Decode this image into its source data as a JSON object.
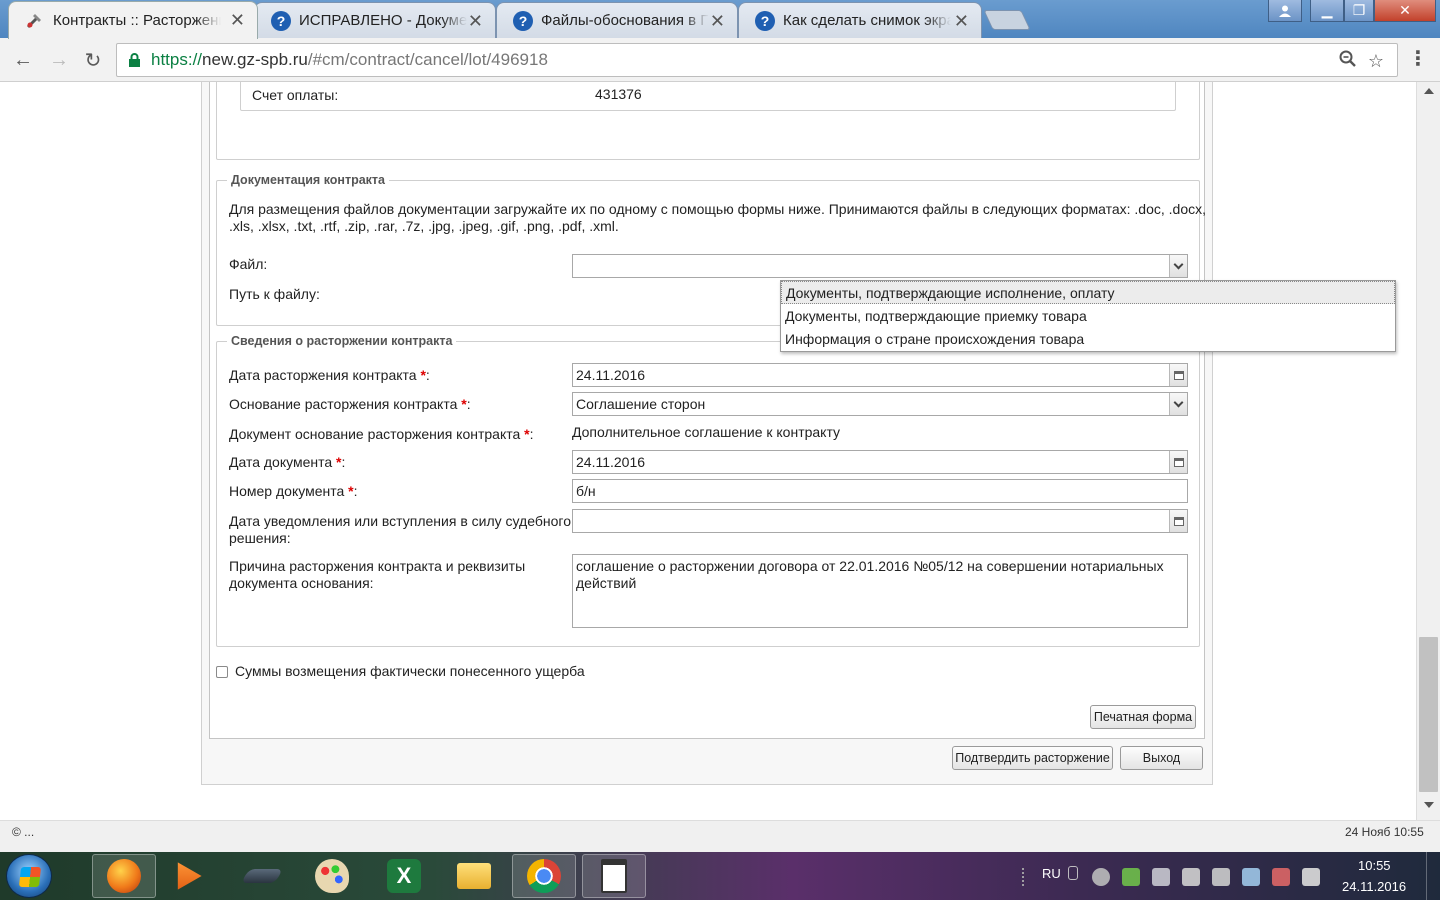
{
  "browser": {
    "tabs": [
      {
        "title": "Контракты :: Расторжение",
        "active": true
      },
      {
        "title": "ИСПРАВЛЕНО - Документы",
        "active": false
      },
      {
        "title": "Файлы-обоснования в ГИС",
        "active": false
      },
      {
        "title": "Как сделать снимок экрана",
        "active": false
      }
    ],
    "url": {
      "scheme": "https://",
      "host": "new.gz-spb.ru",
      "path": "/#cm/contract/cancel/lot/496918"
    }
  },
  "page": {
    "payment": {
      "label": "Счет оплаты:",
      "value": "431376"
    },
    "documentation": {
      "legend": "Документация контракта",
      "instructions_line1": "Для размещения файлов документации загружайте их по одному с помощью формы ниже. Принимаются файлы в следующих форматах: .doc, .docx,",
      "instructions_line2": ".xls, .xlsx, .txt, .rtf, .zip, .rar, .7z, .jpg, .jpeg, .gif, .png, .pdf, .xml.",
      "file_label": "Файл:",
      "file_value": "",
      "path_label": "Путь к файлу:",
      "dropdown_options": [
        "Документы, подтверждающие исполнение, оплату",
        "Документы, подтверждающие приемку товара",
        "Информация о стране происхождения товара"
      ]
    },
    "termination": {
      "legend": "Сведения о расторжении контракта",
      "required_mark": "*",
      "date_label": "Дата расторжения контракта ",
      "date_value": "24.11.2016",
      "basis_label": "Основание расторжения контракта ",
      "basis_value": "Соглашение сторон",
      "doc_basis_label": "Документ основание расторжения контракта ",
      "doc_basis_value": "Дополнительное соглашение к контракту",
      "doc_date_label": "Дата документа ",
      "doc_date_value": "24.11.2016",
      "doc_number_label": "Номер документа ",
      "doc_number_value": "б/н",
      "notice_date_label_line1": "Дата уведомления или вступления в силу судебного",
      "notice_date_label_line2": "решения:",
      "notice_date_value": "",
      "reason_label_line1": "Причина расторжения контракта и реквизиты",
      "reason_label_line2": "документа основания:",
      "reason_value_line1": "соглашение о расторжении договора от 22.01.2016 №05/12 на совершении нотариальных",
      "reason_value_line2": "действий"
    },
    "damages_checkbox_label": "Суммы возмещения фактически понесенного ущерба",
    "print_button": "Печатная форма",
    "confirm_button": "Подтвердить расторжение",
    "exit_button": "Выход"
  },
  "statusbar": {
    "left": "© ...",
    "right": "24 Нояб 10:55"
  },
  "taskbar": {
    "lang": "RU",
    "time": "10:55",
    "date": "24.11.2016"
  }
}
